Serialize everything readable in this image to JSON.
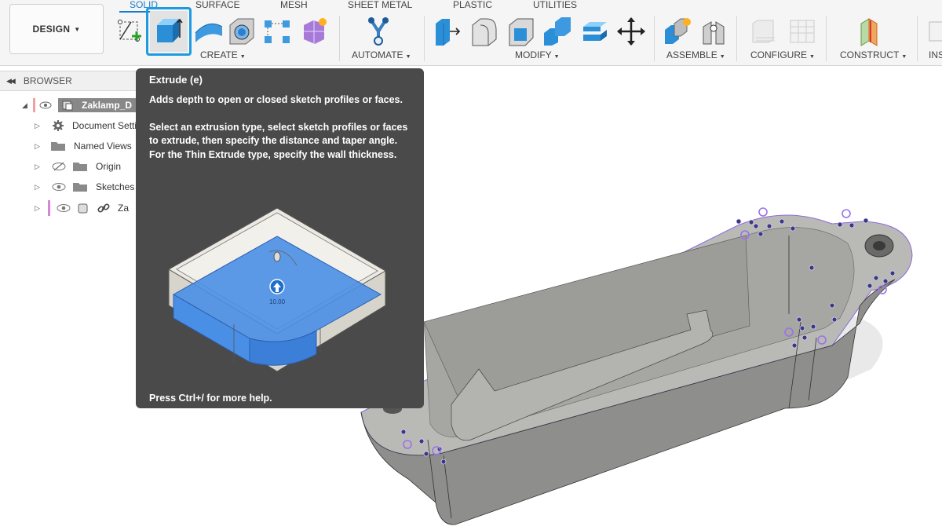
{
  "toolbar": {
    "workspace_button": "DESIGN",
    "tabs": [
      "SOLID",
      "SURFACE",
      "MESH",
      "SHEET METAL",
      "PLASTIC",
      "UTILITIES"
    ],
    "groups": {
      "create": "CREATE",
      "automate": "AUTOMATE",
      "modify": "MODIFY",
      "assemble": "ASSEMBLE",
      "configure": "CONFIGURE",
      "construct": "CONSTRUCT",
      "insert": "INS"
    },
    "accent_color": "#1a7dc9",
    "highlight_color": "#1d9be0"
  },
  "browser": {
    "title": "BROWSER",
    "items": [
      {
        "label": "Zaklamp_D",
        "icon": "component-icon"
      },
      {
        "label": "Document Setti",
        "icon": "gear-icon"
      },
      {
        "label": "Named Views",
        "icon": "folder-icon"
      },
      {
        "label": "Origin",
        "icon": "folder-icon"
      },
      {
        "label": "Sketches",
        "icon": "folder-icon"
      },
      {
        "label": "Za",
        "icon": "link-icon"
      }
    ]
  },
  "tooltip": {
    "title": "Extrude (e)",
    "description": "Adds depth to open or closed sketch profiles or faces.",
    "instructions": "Select an extrusion type, select sketch profiles or faces to extrude, then specify the distance and taper angle. For the Thin Extrude type, specify the wall thickness.",
    "illustration_value": "10.00",
    "footer": "Press Ctrl+/ for more help.",
    "background": "#4a4a4a"
  },
  "viewport": {
    "model_color": "#8e8e8c",
    "sketch_color": "#8a6bd8"
  }
}
